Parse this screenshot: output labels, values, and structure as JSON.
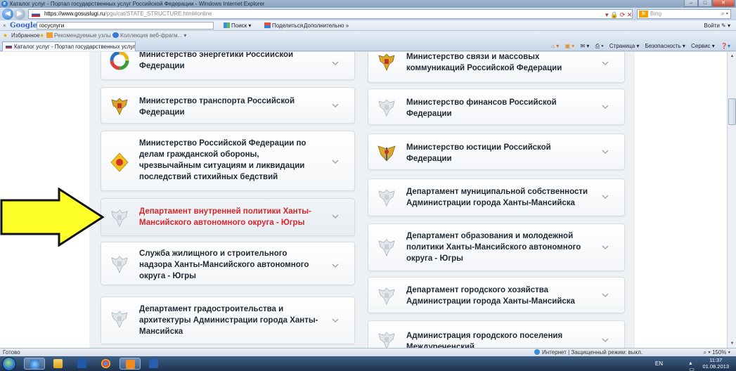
{
  "window": {
    "title": "Каталог услуг - Портал государственных услуг Российской Федерации - Windows Internet Explorer",
    "min": "–",
    "max": "□",
    "close": "✕"
  },
  "address": {
    "host": "https://www.gosuslugi.ru",
    "path": "/pgu/cat/STATE_STRUCTURE.html#online",
    "search_engine": "Bing",
    "search_placeholder": "Bing"
  },
  "google_toolbar": {
    "close": "×",
    "logo": "Google",
    "query": "госуслуги",
    "search": "Поиск ▾",
    "share": "Поделиться",
    "more": "Дополнительно »",
    "signin": "Войти ✎ ▾"
  },
  "favorites": {
    "label": "Избранное",
    "items": [
      "Рекомендуемые узлы ▾",
      "Коллекция веб-фрагм... ▾"
    ]
  },
  "tab": {
    "title": "Каталог услуг - Портал государственных услуг..."
  },
  "commands": [
    "Страница ▾",
    "Безопасность ▾",
    "Сервис ▾"
  ],
  "cards": [
    {
      "id": "energy",
      "title": "Министерство энергетики Российской Федерации",
      "emblem": "energy-logo-icon",
      "active": false
    },
    {
      "id": "transport",
      "title": "Министерство транспорта Российской Федерации",
      "emblem": "eagle-emblem-icon",
      "active": false
    },
    {
      "id": "mchs",
      "title": "Министерство Российской Федерации по делам гражданской обороны, чрезвычайным ситуациям и ликвидации последствий стихийных бедствий",
      "emblem": "mchs-emblem-icon",
      "active": false
    },
    {
      "id": "internal-policy",
      "title": "Департамент внутренней политики Ханты-Мансийского автономного округа - Югры",
      "emblem": "gray-emblem-icon",
      "active": true
    },
    {
      "id": "housing",
      "title": "Служба жилищного и строительного надзора Ханты-Мансийского автономного округа - Югры",
      "emblem": "gray-emblem-icon",
      "active": false
    },
    {
      "id": "urban",
      "title": "Департамент градостроительства и архитектуры Администрации города Ханты-Мансийска",
      "emblem": "gray-emblem-icon",
      "active": false
    },
    {
      "id": "communications",
      "title": "Министерство связи и массовых коммуникаций Российской Федерации",
      "emblem": "eagle-emblem-icon",
      "active": false
    },
    {
      "id": "finance",
      "title": "Министерство финансов Российской Федерации",
      "emblem": "gray-emblem-icon",
      "active": false
    },
    {
      "id": "justice",
      "title": "Министерство юстиции Российской Федерации",
      "emblem": "justice-emblem-icon",
      "active": false
    },
    {
      "id": "municipal-property",
      "title": "Департамент муниципальной собственности Администрации города Ханты-Мансийска",
      "emblem": "gray-emblem-icon",
      "active": false
    },
    {
      "id": "education",
      "title": "Департамент образования и молодежной политики Ханты-Мансийского автономного округа - Югры",
      "emblem": "gray-emblem-icon",
      "active": false
    },
    {
      "id": "city-economy",
      "title": "Департамент городского хозяйства Администрации города Ханты-Мансийска",
      "emblem": "gray-emblem-icon",
      "active": false
    },
    {
      "id": "mezhdurechensky",
      "title": "Администрация городского поселения Междуреченский",
      "emblem": "gray-emblem-icon",
      "active": false
    }
  ],
  "status": {
    "ready": "Готово",
    "zone": "Интернет | Защищенный режим: выкл.",
    "zoom": "150%"
  },
  "tray": {
    "lang": "EN",
    "time": "11:37",
    "date": "01.08.2013"
  },
  "colors": {
    "active_text": "#d6262b",
    "arrow_fill": "#ffff2a",
    "panel_bg": "#eef1f4"
  }
}
